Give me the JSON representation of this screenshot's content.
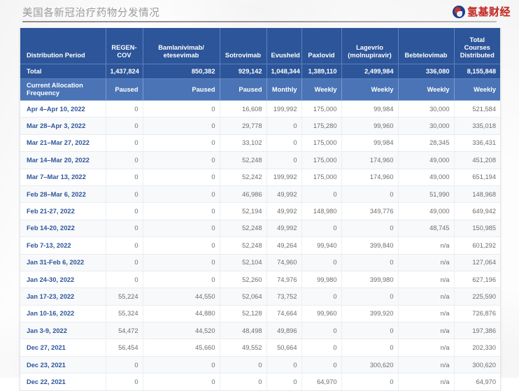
{
  "header": {
    "title": "美国各新冠治疗药物分发情况",
    "brand_text": "氢基财经",
    "brand_icon": "circular-logo-mark"
  },
  "table": {
    "columns": [
      "Distribution Period",
      "REGEN-COV",
      "Bamlanivimab/ etesevimab",
      "Sotrovimab",
      "Evusheld",
      "Paxlovid",
      "Lagevrio (molnupiravir)",
      "Bebtelovimab",
      "Total Courses Distributed"
    ],
    "total_row": {
      "label": "Total",
      "values": [
        "1,437,824",
        "850,382",
        "929,142",
        "1,048,344",
        "1,389,110",
        "2,499,984",
        "336,080",
        "8,155,848"
      ]
    },
    "frequency_row": {
      "label": "Current Allocation Frequency",
      "values": [
        "Paused",
        "Paused",
        "Paused",
        "Monthly",
        "Weekly",
        "Weekly",
        "Weekly",
        "Weekly"
      ]
    },
    "rows": [
      {
        "period": "Apr 4–Apr 10, 2022",
        "values": [
          "0",
          "0",
          "16,608",
          "199,992",
          "175,000",
          "99,984",
          "30,000",
          "521,584"
        ]
      },
      {
        "period": "Mar 28–Apr 3, 2022",
        "values": [
          "0",
          "0",
          "29,778",
          "0",
          "175,280",
          "99,960",
          "30,000",
          "335,018"
        ]
      },
      {
        "period": "Mar 21–Mar 27, 2022",
        "values": [
          "0",
          "0",
          "33,102",
          "0",
          "175,000",
          "99,984",
          "28,345",
          "336,431"
        ]
      },
      {
        "period": "Mar 14–Mar 20, 2022",
        "values": [
          "0",
          "0",
          "52,248",
          "0",
          "175,000",
          "174,960",
          "49,000",
          "451,208"
        ]
      },
      {
        "period": "Mar 7–Mar 13, 2022",
        "values": [
          "0",
          "0",
          "52,242",
          "199,992",
          "175,000",
          "174,960",
          "49,000",
          "651,194"
        ]
      },
      {
        "period": "Feb 28–Mar 6, 2022",
        "values": [
          "0",
          "0",
          "46,986",
          "49,992",
          "0",
          "0",
          "51,990",
          "148,968"
        ]
      },
      {
        "period": "Feb 21-27, 2022",
        "values": [
          "0",
          "0",
          "52,194",
          "49,992",
          "148,980",
          "349,776",
          "49,000",
          "649,942"
        ]
      },
      {
        "period": "Feb 14-20, 2022",
        "values": [
          "0",
          "0",
          "52,248",
          "49,992",
          "0",
          "0",
          "48,745",
          "150,985"
        ]
      },
      {
        "period": "Feb 7-13, 2022",
        "values": [
          "0",
          "0",
          "52,248",
          "49,264",
          "99,940",
          "399,840",
          "n/a",
          "601,292"
        ]
      },
      {
        "period": "Jan 31-Feb 6, 2022",
        "values": [
          "0",
          "0",
          "52,104",
          "74,960",
          "0",
          "0",
          "n/a",
          "127,064"
        ]
      },
      {
        "period": "Jan 24-30, 2022",
        "values": [
          "0",
          "0",
          "52,260",
          "74,976",
          "99,980",
          "399,980",
          "n/a",
          "627,196"
        ]
      },
      {
        "period": "Jan 17-23, 2022",
        "values": [
          "55,224",
          "44,550",
          "52,064",
          "73,752",
          "0",
          "0",
          "n/a",
          "225,590"
        ]
      },
      {
        "period": "Jan 10-16, 2022",
        "values": [
          "55,324",
          "44,880",
          "52,128",
          "74,664",
          "99,960",
          "399,920",
          "n/a",
          "726,876"
        ]
      },
      {
        "period": "Jan 3-9, 2022",
        "values": [
          "54,472",
          "44,520",
          "48,498",
          "49,896",
          "0",
          "0",
          "n/a",
          "197,386"
        ]
      },
      {
        "period": "Dec 27, 2021",
        "values": [
          "56,454",
          "45,660",
          "49,552",
          "50,664",
          "0",
          "0",
          "n/a",
          "202,330"
        ]
      },
      {
        "period": "Dec 23, 2021",
        "values": [
          "0",
          "0",
          "0",
          "0",
          "0",
          "300,620",
          "n/a",
          "300,620"
        ]
      },
      {
        "period": "Dec 22, 2021",
        "values": [
          "0",
          "0",
          "0",
          "0",
          "64,970",
          "0",
          "n/a",
          "64,970"
        ]
      }
    ]
  },
  "colors": {
    "header_blue": "#2d5599",
    "frequency_blue": "#4a74b5",
    "brand_red": "#c42b24",
    "row_alt": "#f7f9fb"
  }
}
